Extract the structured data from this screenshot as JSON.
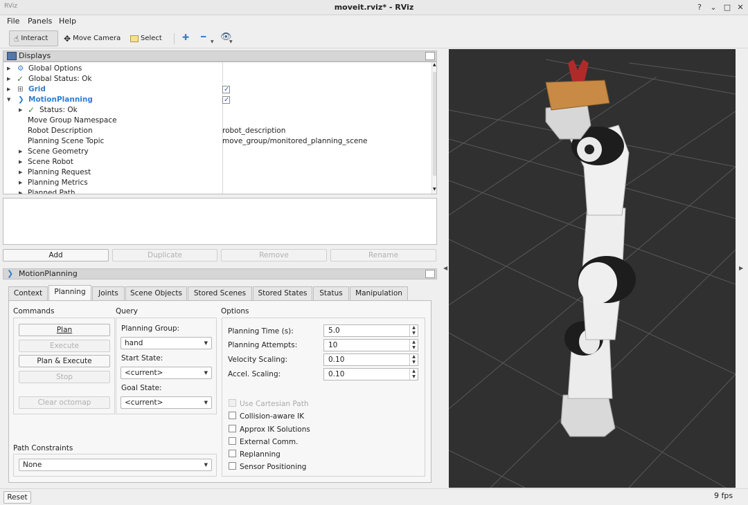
{
  "window": {
    "app_tag": "RViz",
    "title": "moveit.rviz* - RViz",
    "controls": {
      "help": "?",
      "minimize": "⌄",
      "maximize": "^",
      "restore": "□",
      "close": "✕"
    }
  },
  "menu": [
    "File",
    "Panels",
    "Help"
  ],
  "toolbar": {
    "interact": "Interact",
    "move_camera": "Move Camera",
    "select": "Select"
  },
  "displays": {
    "title": "Displays",
    "rows": [
      {
        "label": "Global Options",
        "value": ""
      },
      {
        "label": "Global Status: Ok",
        "value": ""
      },
      {
        "label": "Grid",
        "value": ""
      },
      {
        "label": "MotionPlanning",
        "value": ""
      },
      {
        "label": "Status: Ok",
        "value": ""
      },
      {
        "label": "Move Group Namespace",
        "value": ""
      },
      {
        "label": "Robot Description",
        "value": "robot_description"
      },
      {
        "label": "Planning Scene Topic",
        "value": "move_group/monitored_planning_scene"
      },
      {
        "label": "Scene Geometry",
        "value": ""
      },
      {
        "label": "Scene Robot",
        "value": ""
      },
      {
        "label": "Planning Request",
        "value": ""
      },
      {
        "label": "Planning Metrics",
        "value": ""
      },
      {
        "label": "Planned Path",
        "value": ""
      }
    ],
    "grid_enabled": true,
    "motionplanning_enabled": true
  },
  "display_buttons": {
    "add": "Add",
    "duplicate": "Duplicate",
    "remove": "Remove",
    "rename": "Rename"
  },
  "motion_panel": {
    "title": "MotionPlanning",
    "tabs": [
      "Context",
      "Planning",
      "Joints",
      "Scene Objects",
      "Stored Scenes",
      "Stored States",
      "Status",
      "Manipulation"
    ],
    "selected_tab": "Planning",
    "commands": {
      "heading": "Commands",
      "plan": "Plan",
      "execute": "Execute",
      "plan_execute": "Plan & Execute",
      "stop": "Stop",
      "clear_octomap": "Clear octomap"
    },
    "query": {
      "heading": "Query",
      "planning_group_label": "Planning Group:",
      "planning_group": "hand",
      "start_state_label": "Start State:",
      "start_state": "<current>",
      "goal_state_label": "Goal State:",
      "goal_state": "<current>"
    },
    "options": {
      "heading": "Options",
      "planning_time_label": "Planning Time (s):",
      "planning_time": "5.0",
      "planning_attempts_label": "Planning Attempts:",
      "planning_attempts": "10",
      "velocity_scaling_label": "Velocity Scaling:",
      "velocity_scaling": "0.10",
      "accel_scaling_label": "Accel. Scaling:",
      "accel_scaling": "0.10",
      "checkboxes": [
        {
          "label": "Use Cartesian Path",
          "checked": false,
          "disabled": true
        },
        {
          "label": "Collision-aware IK",
          "checked": false,
          "disabled": false
        },
        {
          "label": "Approx IK Solutions",
          "checked": false,
          "disabled": false
        },
        {
          "label": "External Comm.",
          "checked": false,
          "disabled": false
        },
        {
          "label": "Replanning",
          "checked": false,
          "disabled": false
        },
        {
          "label": "Sensor Positioning",
          "checked": false,
          "disabled": false
        }
      ]
    },
    "path_constraints": {
      "heading": "Path Constraints",
      "value": "None"
    }
  },
  "statusbar": {
    "reset": "Reset",
    "fps": "9 fps"
  },
  "colors": {
    "accent": "#2f7dd1",
    "status_ok": "#3a8a3a",
    "viewport_bg": "#303030",
    "grid": "#5a5a5a",
    "gripper": "#c88a45"
  }
}
